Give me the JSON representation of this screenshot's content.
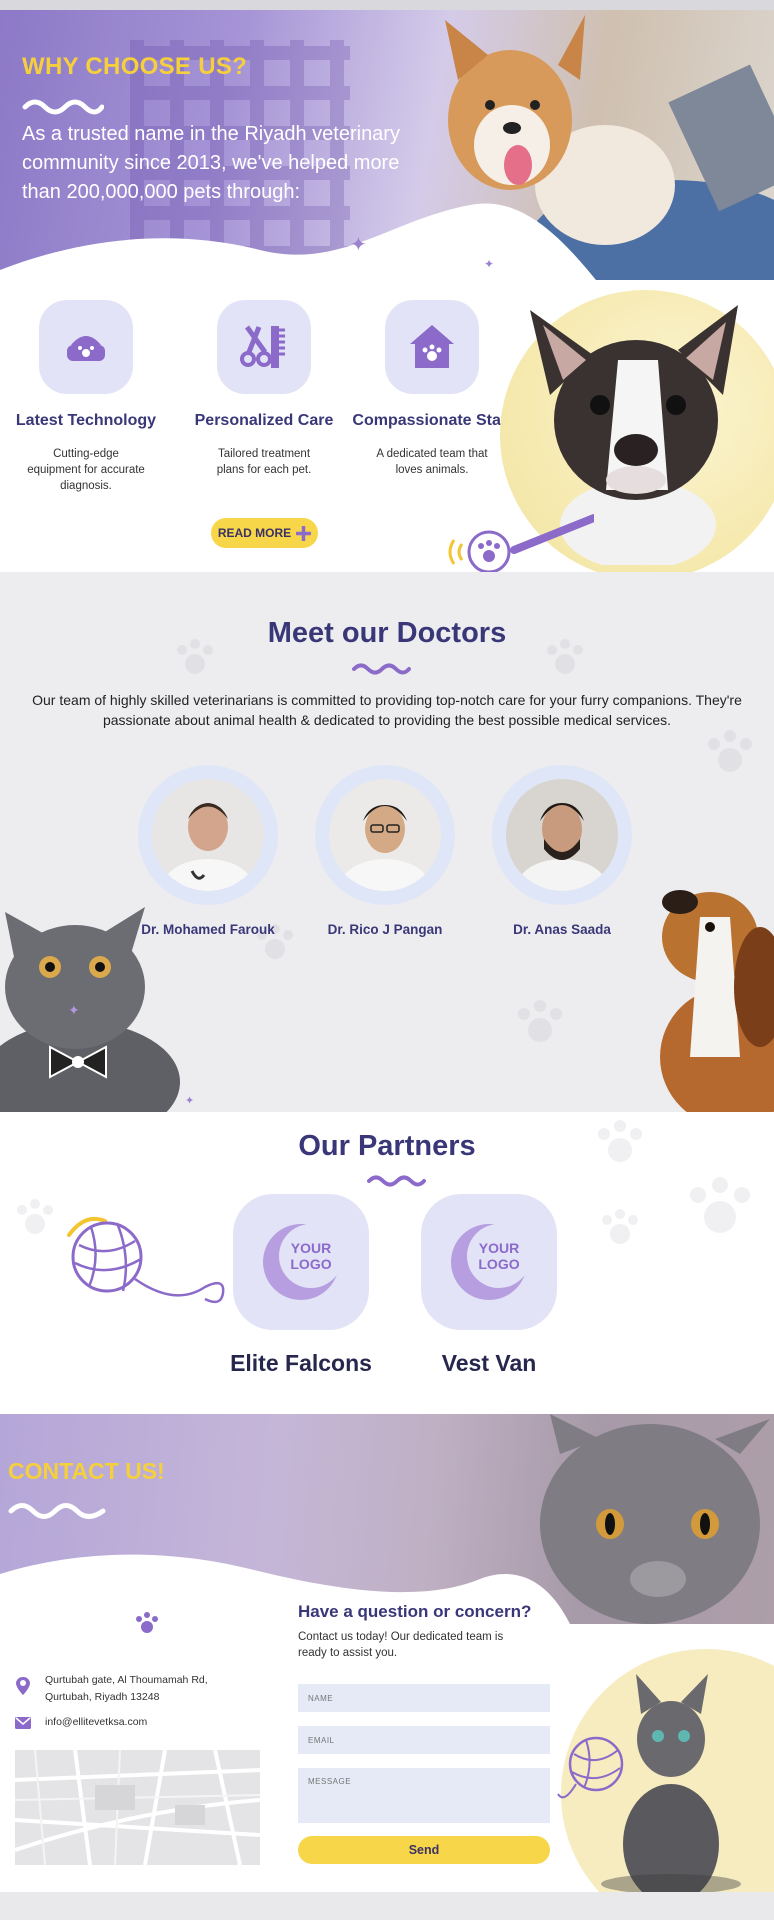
{
  "why": {
    "title": "WHY CHOOSE US?",
    "intro": "As a trusted name in the Riyadh veterinary community since 2013, we've helped more than 200,000,000 pets through:",
    "features": [
      {
        "icon": "pet-bowl-icon",
        "title": "Latest Technology",
        "desc": "Cutting-edge equipment for accurate diagnosis."
      },
      {
        "icon": "grooming-scissors-comb-icon",
        "title": "Personalized Care",
        "desc": "Tailored treatment plans for each pet."
      },
      {
        "icon": "pet-house-icon",
        "title": "Compassionate Staff",
        "desc": "A dedicated team that loves animals."
      }
    ],
    "read_more": "READ MORE"
  },
  "doctors": {
    "title": "Meet our Doctors",
    "description": "Our team of highly skilled veterinarians is committed to providing top-notch care for your furry companions. They're passionate about animal health & dedicated to providing the best possible medical services.",
    "list": [
      {
        "name": "Dr. Mohamed Farouk"
      },
      {
        "name": "Dr. Rico J Pangan"
      },
      {
        "name": "Dr. Anas Saada"
      }
    ]
  },
  "partners": {
    "title": "Our Partners",
    "logo_text_1": "YOUR",
    "logo_text_2": "LOGO",
    "list": [
      {
        "name": "Elite Falcons"
      },
      {
        "name": "Vest Van"
      }
    ]
  },
  "contact": {
    "title": "CONTACT US!",
    "address_line1": "Qurtubah gate, Al Thoumamah Rd,",
    "address_line2": "Qurtubah, Riyadh 13248",
    "email": "info@ellitevetksa.com",
    "form_title": "Have a question or concern?",
    "form_subtitle": "Contact us today! Our dedicated team is ready to assist you.",
    "name_placeholder": "NAME",
    "email_placeholder": "EMAIL",
    "message_placeholder": "MESSAGE",
    "send_label": "Send"
  },
  "colors": {
    "accent_yellow": "#f6cf3c",
    "brand_purple": "#3a3779",
    "lavender": "#e3e3f7"
  }
}
